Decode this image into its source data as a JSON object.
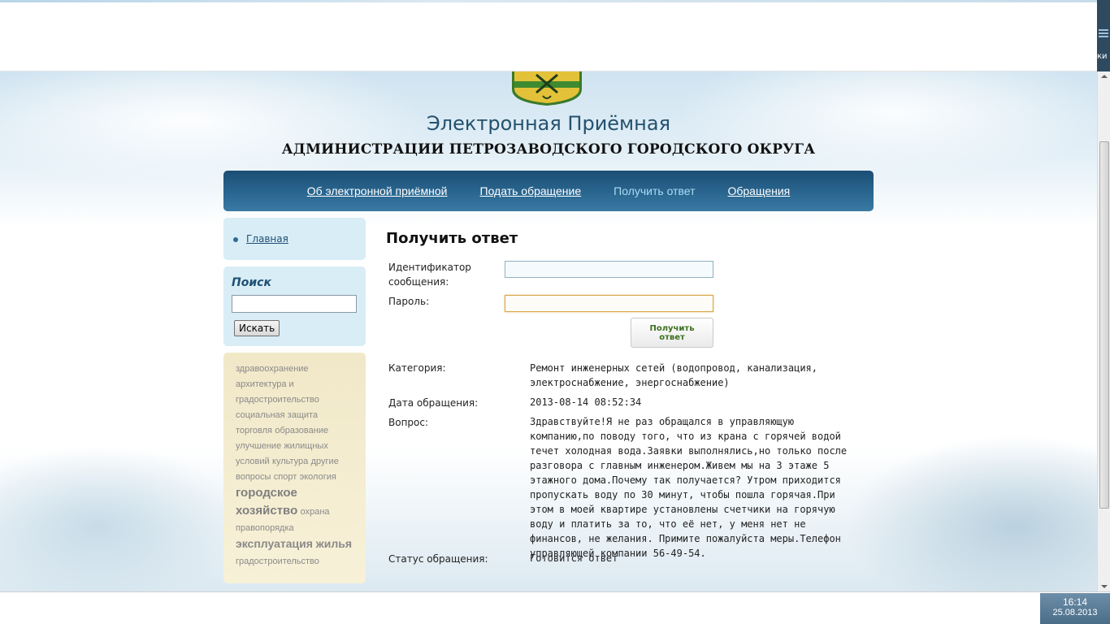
{
  "header": {
    "title": "Электронная Приёмная",
    "subtitle": "АДМИНИСТРАЦИИ ПЕТРОЗАВОДСКОГО ГОРОДСКОГО ОКРУГА"
  },
  "browser": {
    "edge_text": "ки"
  },
  "nav": {
    "items": [
      {
        "label": "Об электронной приёмной"
      },
      {
        "label": "Подать обращение"
      },
      {
        "label": "Получить ответ"
      },
      {
        "label": "Обращения"
      }
    ],
    "active_index": 2
  },
  "sidebar": {
    "home_link": "Главная",
    "search": {
      "title": "Поиск",
      "input_value": "",
      "button_label": "Искать"
    },
    "tags": [
      {
        "label": "здравоохранение"
      },
      {
        "label": "архитектура и градостроительство"
      },
      {
        "label": "социальная защита"
      },
      {
        "label": "торговля"
      },
      {
        "label": "образование"
      },
      {
        "label": "улучшение жилищных условий"
      },
      {
        "label": "культура"
      },
      {
        "label": "другие вопросы"
      },
      {
        "label": "спорт"
      },
      {
        "label": "экология"
      },
      {
        "label": "городское хозяйство"
      },
      {
        "label": "охрана правопорядка"
      },
      {
        "label": "эксплуатация жилья"
      },
      {
        "label": "градостроительство"
      }
    ]
  },
  "main": {
    "title": "Получить ответ",
    "form": {
      "id_label": "Идентификатор сообщения:",
      "id_value": "",
      "password_label": "Пароль:",
      "password_value": "",
      "submit_label": "Получить ответ"
    },
    "result": {
      "category_label": "Категория:",
      "category_value": "Ремонт инженерных сетей (водопровод, канализация, электроснабжение, энергоснабжение)",
      "date_label": "Дата обращения:",
      "date_value": "2013-08-14 08:52:34",
      "question_label": "Вопрос:",
      "question_value": "Здравствуйте!Я не раз обращался в управляющую компанию,по поводу того, что из крана с горячей водой течет холодная вода.Заявки выполнялись,но только после разговора с главным инженером.Живем мы на 3 этаже 5 этажного дома.Почему так получается? Утром приходится пропускать воду по 30 минут, чтобы пошла горячая.При этом в моей квартире установлены счетчики на горячую воду и платить за то, что её нет, у меня нет не финансов, не желания. Примите пожалуйста меры.Телефон управляющей компании 56-49-54.",
      "status_label": "Статус обращения:",
      "status_value": "Готовится ответ"
    }
  },
  "taskbar": {
    "time": "16:14",
    "date": "25.08.2013"
  }
}
